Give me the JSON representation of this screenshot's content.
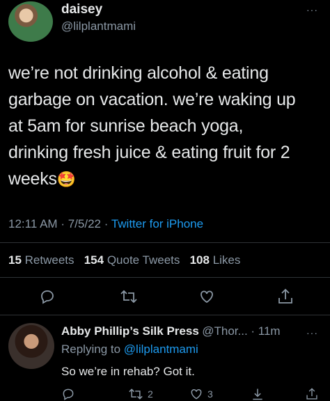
{
  "tweet": {
    "author_name": "daisey",
    "author_handle": "@lilplantmami",
    "text_lines": [
      "we’re not drinking alcohol & eating",
      "garbage on vacation. we’re waking up",
      "at 5am for sunrise beach yoga,",
      "drinking fresh juice & eating fruit for 2",
      "weeks"
    ],
    "emoji": "🤩",
    "time": "12:11 AM",
    "date": "7/5/22",
    "separator": "·",
    "source": "Twitter for iPhone"
  },
  "stats": {
    "retweets_count": "15",
    "retweets_label": "Retweets",
    "quotes_count": "154",
    "quotes_label": "Quote Tweets",
    "likes_count": "108",
    "likes_label": "Likes"
  },
  "actions": {
    "icons": [
      "reply-icon",
      "retweet-icon",
      "like-icon",
      "share-icon"
    ]
  },
  "reply": {
    "author_name": "Abby Phillip’s Silk Press",
    "author_handle_time": "@Thor... · 11m",
    "replying_label": "Replying to",
    "replying_handle": "@lilplantmami",
    "text": "So we’re in rehab? Got it.",
    "retweets": "2",
    "likes": "3"
  },
  "more_label": "···",
  "colors": {
    "background": "#000000",
    "text": "#e7e9ea",
    "secondary": "#8b98a5",
    "accent": "#1d9bf0",
    "divider": "#2f3336"
  }
}
